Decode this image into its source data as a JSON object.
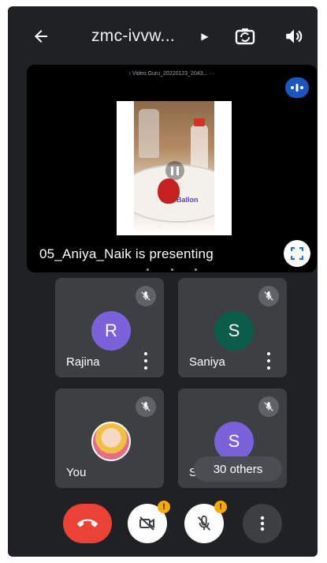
{
  "header": {
    "meeting_code": "zmc-ivvw...",
    "back_icon": "arrow-back-icon",
    "switch_camera_icon": "camera-switch-icon",
    "audio_icon": "speaker-icon"
  },
  "presentation": {
    "file_name": "‹ Video.Guru_20220123_2043...   ···",
    "presenter_label": "05_Aniya_Naik is presenting",
    "video_caption": "Ballon",
    "fullscreen_icon": "fullscreen-icon"
  },
  "participants": [
    {
      "name": "Rajina",
      "initial": "R",
      "avatar_color": "#7b62d9",
      "muted": true
    },
    {
      "name": "Saniya",
      "initial": "S",
      "avatar_color": "#0c5c4a",
      "muted": true
    },
    {
      "name": "You",
      "initial": "",
      "muted": true
    },
    {
      "name": "S",
      "initial": "S",
      "avatar_color": "#7b62d9",
      "muted": true
    }
  ],
  "others_count_label": "30 others",
  "controls": {
    "end_call_icon": "end-call-icon",
    "camera_icon": "camera-off-icon",
    "mic_icon": "mic-off-icon",
    "more_icon": "more-options-icon",
    "warning_badge": "!"
  },
  "colors": {
    "background": "#202124",
    "tile": "#3c4043",
    "end_call": "#ea4335",
    "warning": "#f9ab00",
    "audio_indicator": "#1a55c0"
  }
}
